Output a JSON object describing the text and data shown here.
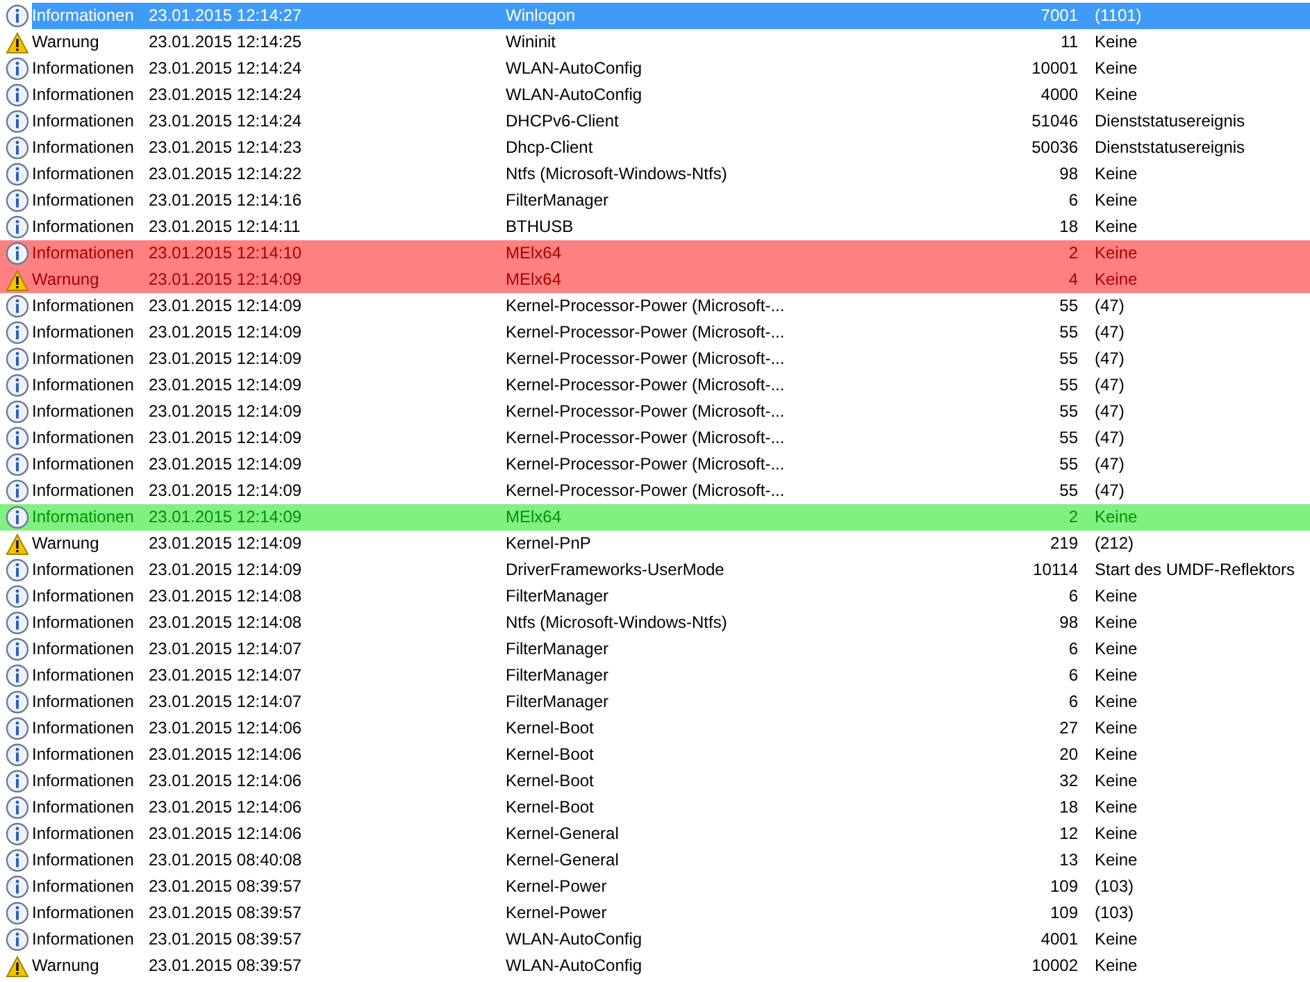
{
  "events": [
    {
      "kind": "information",
      "level": "Informationen",
      "date": "23.01.2015 12:14:27",
      "source": "Winlogon",
      "event_id": "7001",
      "category": "(1101)",
      "selected": true
    },
    {
      "kind": "warning",
      "level": "Warnung",
      "date": "23.01.2015 12:14:25",
      "source": "Wininit",
      "event_id": "11",
      "category": "Keine",
      "selected": false
    },
    {
      "kind": "information",
      "level": "Informationen",
      "date": "23.01.2015 12:14:24",
      "source": "WLAN-AutoConfig",
      "event_id": "10001",
      "category": "Keine",
      "selected": false
    },
    {
      "kind": "information",
      "level": "Informationen",
      "date": "23.01.2015 12:14:24",
      "source": "WLAN-AutoConfig",
      "event_id": "4000",
      "category": "Keine",
      "selected": false
    },
    {
      "kind": "information",
      "level": "Informationen",
      "date": "23.01.2015 12:14:24",
      "source": "DHCPv6-Client",
      "event_id": "51046",
      "category": "Dienststatusereignis",
      "selected": false
    },
    {
      "kind": "information",
      "level": "Informationen",
      "date": "23.01.2015 12:14:23",
      "source": "Dhcp-Client",
      "event_id": "50036",
      "category": "Dienststatusereignis",
      "selected": false
    },
    {
      "kind": "information",
      "level": "Informationen",
      "date": "23.01.2015 12:14:22",
      "source": "Ntfs (Microsoft-Windows-Ntfs)",
      "event_id": "98",
      "category": "Keine",
      "selected": false
    },
    {
      "kind": "information",
      "level": "Informationen",
      "date": "23.01.2015 12:14:16",
      "source": "FilterManager",
      "event_id": "6",
      "category": "Keine",
      "selected": false
    },
    {
      "kind": "information",
      "level": "Informationen",
      "date": "23.01.2015 12:14:11",
      "source": "BTHUSB",
      "event_id": "18",
      "category": "Keine",
      "selected": false
    },
    {
      "kind": "information",
      "level": "Informationen",
      "date": "23.01.2015 12:14:10",
      "source": "MElx64",
      "event_id": "2",
      "category": "Keine",
      "selected": false,
      "color": "#ff8080"
    },
    {
      "kind": "warning",
      "level": "Warnung",
      "date": "23.01.2015 12:14:09",
      "source": "MElx64",
      "event_id": "4",
      "category": "Keine",
      "selected": false,
      "color": "#ff8080"
    },
    {
      "kind": "information",
      "level": "Informationen",
      "date": "23.01.2015 12:14:09",
      "source": "Kernel-Processor-Power (Microsoft-...",
      "event_id": "55",
      "category": "(47)",
      "selected": false
    },
    {
      "kind": "information",
      "level": "Informationen",
      "date": "23.01.2015 12:14:09",
      "source": "Kernel-Processor-Power (Microsoft-...",
      "event_id": "55",
      "category": "(47)",
      "selected": false
    },
    {
      "kind": "information",
      "level": "Informationen",
      "date": "23.01.2015 12:14:09",
      "source": "Kernel-Processor-Power (Microsoft-...",
      "event_id": "55",
      "category": "(47)",
      "selected": false
    },
    {
      "kind": "information",
      "level": "Informationen",
      "date": "23.01.2015 12:14:09",
      "source": "Kernel-Processor-Power (Microsoft-...",
      "event_id": "55",
      "category": "(47)",
      "selected": false
    },
    {
      "kind": "information",
      "level": "Informationen",
      "date": "23.01.2015 12:14:09",
      "source": "Kernel-Processor-Power (Microsoft-...",
      "event_id": "55",
      "category": "(47)",
      "selected": false
    },
    {
      "kind": "information",
      "level": "Informationen",
      "date": "23.01.2015 12:14:09",
      "source": "Kernel-Processor-Power (Microsoft-...",
      "event_id": "55",
      "category": "(47)",
      "selected": false
    },
    {
      "kind": "information",
      "level": "Informationen",
      "date": "23.01.2015 12:14:09",
      "source": "Kernel-Processor-Power (Microsoft-...",
      "event_id": "55",
      "category": "(47)",
      "selected": false
    },
    {
      "kind": "information",
      "level": "Informationen",
      "date": "23.01.2015 12:14:09",
      "source": "Kernel-Processor-Power (Microsoft-...",
      "event_id": "55",
      "category": "(47)",
      "selected": false
    },
    {
      "kind": "information",
      "level": "Informationen",
      "date": "23.01.2015 12:14:09",
      "source": "MElx64",
      "event_id": "2",
      "category": "Keine",
      "selected": false,
      "color": "#80f080"
    },
    {
      "kind": "warning",
      "level": "Warnung",
      "date": "23.01.2015 12:14:09",
      "source": "Kernel-PnP",
      "event_id": "219",
      "category": "(212)",
      "selected": false
    },
    {
      "kind": "information",
      "level": "Informationen",
      "date": "23.01.2015 12:14:09",
      "source": "DriverFrameworks-UserMode",
      "event_id": "10114",
      "category": "Start des UMDF-Reflektors",
      "selected": false
    },
    {
      "kind": "information",
      "level": "Informationen",
      "date": "23.01.2015 12:14:08",
      "source": "FilterManager",
      "event_id": "6",
      "category": "Keine",
      "selected": false
    },
    {
      "kind": "information",
      "level": "Informationen",
      "date": "23.01.2015 12:14:08",
      "source": "Ntfs (Microsoft-Windows-Ntfs)",
      "event_id": "98",
      "category": "Keine",
      "selected": false
    },
    {
      "kind": "information",
      "level": "Informationen",
      "date": "23.01.2015 12:14:07",
      "source": "FilterManager",
      "event_id": "6",
      "category": "Keine",
      "selected": false
    },
    {
      "kind": "information",
      "level": "Informationen",
      "date": "23.01.2015 12:14:07",
      "source": "FilterManager",
      "event_id": "6",
      "category": "Keine",
      "selected": false
    },
    {
      "kind": "information",
      "level": "Informationen",
      "date": "23.01.2015 12:14:07",
      "source": "FilterManager",
      "event_id": "6",
      "category": "Keine",
      "selected": false
    },
    {
      "kind": "information",
      "level": "Informationen",
      "date": "23.01.2015 12:14:06",
      "source": "Kernel-Boot",
      "event_id": "27",
      "category": "Keine",
      "selected": false
    },
    {
      "kind": "information",
      "level": "Informationen",
      "date": "23.01.2015 12:14:06",
      "source": "Kernel-Boot",
      "event_id": "20",
      "category": "Keine",
      "selected": false
    },
    {
      "kind": "information",
      "level": "Informationen",
      "date": "23.01.2015 12:14:06",
      "source": "Kernel-Boot",
      "event_id": "32",
      "category": "Keine",
      "selected": false
    },
    {
      "kind": "information",
      "level": "Informationen",
      "date": "23.01.2015 12:14:06",
      "source": "Kernel-Boot",
      "event_id": "18",
      "category": "Keine",
      "selected": false
    },
    {
      "kind": "information",
      "level": "Informationen",
      "date": "23.01.2015 12:14:06",
      "source": "Kernel-General",
      "event_id": "12",
      "category": "Keine",
      "selected": false
    },
    {
      "kind": "information",
      "level": "Informationen",
      "date": "23.01.2015 08:40:08",
      "source": "Kernel-General",
      "event_id": "13",
      "category": "Keine",
      "selected": false
    },
    {
      "kind": "information",
      "level": "Informationen",
      "date": "23.01.2015 08:39:57",
      "source": "Kernel-Power",
      "event_id": "109",
      "category": "(103)",
      "selected": false
    },
    {
      "kind": "information",
      "level": "Informationen",
      "date": "23.01.2015 08:39:57",
      "source": "Kernel-Power",
      "event_id": "109",
      "category": "(103)",
      "selected": false
    },
    {
      "kind": "information",
      "level": "Informationen",
      "date": "23.01.2015 08:39:57",
      "source": "WLAN-AutoConfig",
      "event_id": "4001",
      "category": "Keine",
      "selected": false
    },
    {
      "kind": "warning",
      "level": "Warnung",
      "date": "23.01.2015 08:39:57",
      "source": "WLAN-AutoConfig",
      "event_id": "10002",
      "category": "Keine",
      "selected": false
    }
  ]
}
